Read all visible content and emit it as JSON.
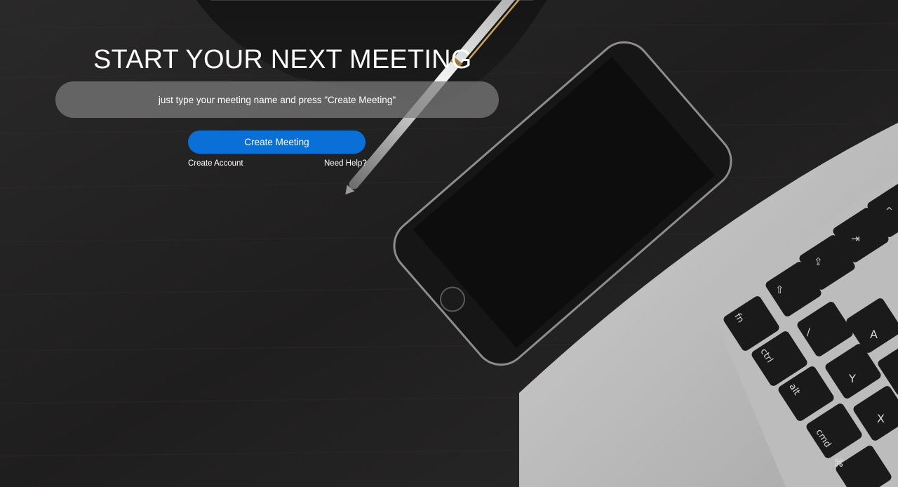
{
  "hero": {
    "title": "START YOUR NEXT MEETING"
  },
  "meeting_form": {
    "input_placeholder": "just type your meeting name and press \"Create Meeting\"",
    "input_value": "",
    "submit_label": "Create Meeting"
  },
  "links": {
    "create_account": "Create Account",
    "need_help": "Need Help?"
  },
  "colors": {
    "accent": "#0a6fd6",
    "background": "#232222",
    "input_fill": "rgba(125,125,125,0.72)",
    "text": "#ffffff"
  },
  "background_photo": {
    "objects": [
      "notebook",
      "pen",
      "smartphone",
      "laptop-keyboard"
    ]
  }
}
